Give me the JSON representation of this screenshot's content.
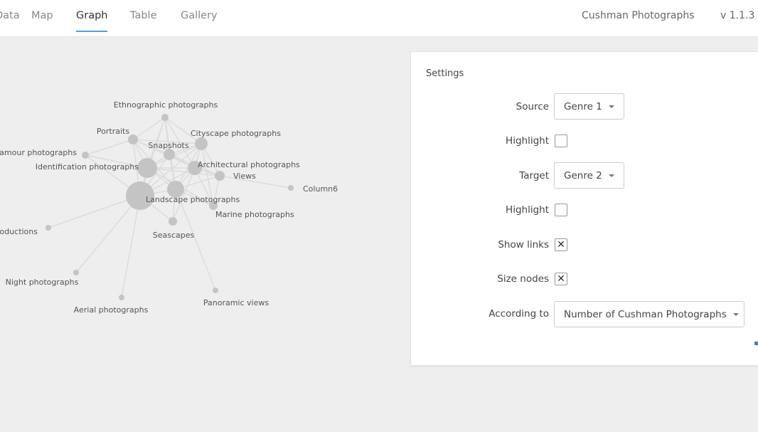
{
  "nav": {
    "tabs": [
      {
        "label": "Data"
      },
      {
        "label": "Map"
      },
      {
        "label": "Graph",
        "active": true
      },
      {
        "label": "Table"
      },
      {
        "label": "Gallery"
      }
    ],
    "project": "Cushman Photographs",
    "version": "v 1.1.3",
    "accent": "#4ca3dd"
  },
  "graph": {
    "nodes": [
      "Ethnographic photographs",
      "Portraits",
      "Glamour photographs",
      "Snapshots",
      "Cityscape photographs",
      "Identification photographs",
      "Architectural photographs",
      "Views",
      "Column6",
      "Landscape photographs",
      "",
      "Marine photographs",
      "Seascapes",
      "Reproductions",
      "Night photographs",
      "Aerial photographs",
      "Panoramic views"
    ],
    "node_color": "#c4c4c4",
    "link_color": "#dcdcdc"
  },
  "settings": {
    "title": "Settings",
    "source_label": "Source",
    "source_value": "Genre 1",
    "highlight_label": "Highlight",
    "source_highlight": false,
    "target_label": "Target",
    "target_value": "Genre 2",
    "target_highlight": false,
    "show_links_label": "Show links",
    "show_links": true,
    "size_nodes_label": "Size nodes",
    "size_nodes": true,
    "according_label": "According to",
    "according_value": "Number of Cushman Photographs",
    "check_mark": "✕"
  }
}
